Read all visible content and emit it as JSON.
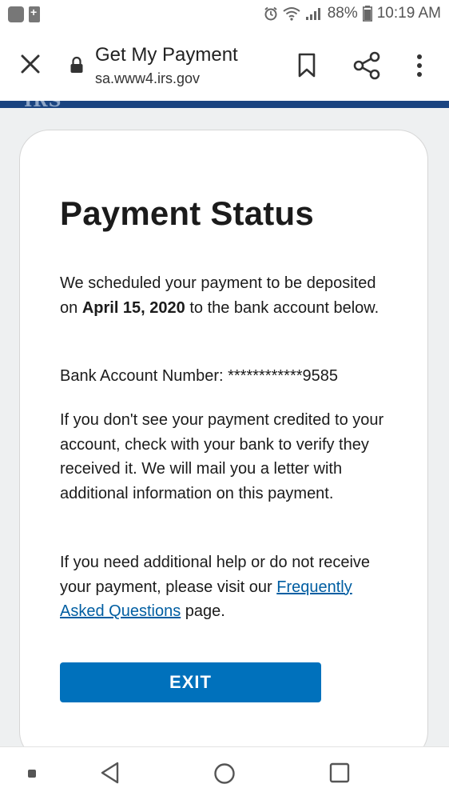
{
  "status_bar": {
    "battery_percent": "88%",
    "time": "10:19 AM",
    "icons": [
      "app-icon",
      "battery-saver-icon",
      "alarm-icon",
      "wifi-icon",
      "signal-icon",
      "battery-icon"
    ]
  },
  "toolbar": {
    "page_title": "Get My Payment",
    "domain": "sa.www4.irs.gov",
    "icons": [
      "close-icon",
      "lock-icon",
      "bookmark-icon",
      "share-icon",
      "more-icon"
    ]
  },
  "banner": {
    "color": "#1a4480",
    "logo_text": "IRS"
  },
  "main": {
    "heading": "Payment Status",
    "para1_before": "We scheduled your payment to be deposited on ",
    "para1_date": "April 15, 2020",
    "para1_after": " to the bank account below.",
    "bank_label": "Bank Account Number: ",
    "bank_number": "************9585",
    "para3": "If you don't see your payment credited to your account, check with your bank to verify they received it. We will mail you a letter with additional information on this payment.",
    "para4_before": "If you need additional help or do not receive your payment, please visit our ",
    "faq_link": "Frequently Asked Questions",
    "para4_after": " page.",
    "exit_label": "EXIT"
  },
  "colors": {
    "accent": "#0071bc",
    "link": "#005ea2",
    "page_background": "#eef0f1"
  },
  "nav_bar": {
    "icons": [
      "notification-dot-icon",
      "back-icon",
      "home-icon",
      "recents-icon"
    ]
  }
}
